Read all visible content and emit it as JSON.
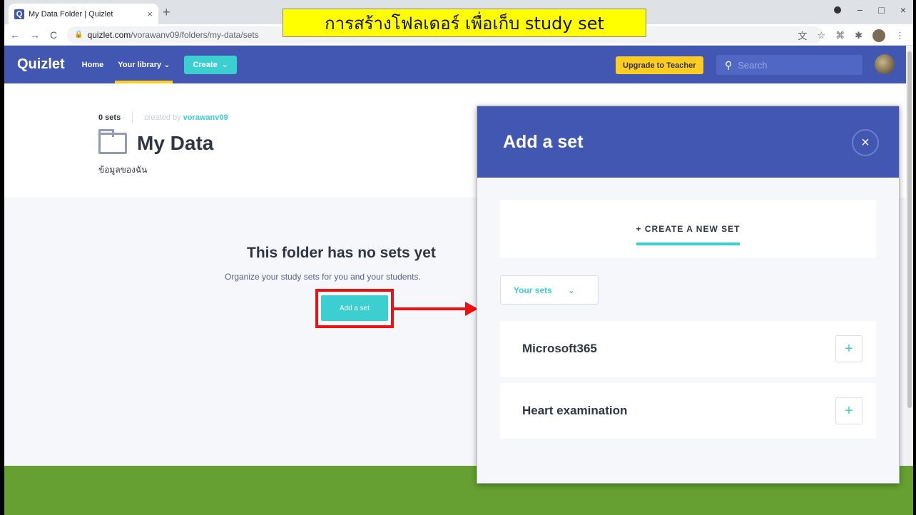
{
  "browser": {
    "tab_title": "My Data Folder | Quizlet",
    "tab_close": "×",
    "new_tab": "+",
    "url_host": "quizlet.com",
    "url_path": "/vorawanv09/folders/my-data/sets",
    "back": "←",
    "forward": "→",
    "reload": "C",
    "win_min": "−",
    "win_max": "□",
    "win_close": "×"
  },
  "banner": {
    "text": "การสร้างโฟลเดอร์ เพื่อเก็บ study set"
  },
  "nav": {
    "logo": "Quizlet",
    "home": "Home",
    "library": "Your library",
    "create": "Create",
    "upgrade": "Upgrade to Teacher",
    "search_placeholder": "Search"
  },
  "folder": {
    "set_count": "0 sets",
    "created_by": "created by",
    "username": "vorawanv09",
    "name": "My Data",
    "description": "ข้อมูลของฉัน"
  },
  "empty_state": {
    "title": "This folder has no sets yet",
    "subtitle": "Organize your study sets for you and your students.",
    "button": "Add a set"
  },
  "modal": {
    "title": "Add a set",
    "close": "×",
    "create_new": "+ CREATE A NEW SET",
    "filter": "Your sets",
    "sets": [
      {
        "name": "Microsoft365",
        "add": "+"
      },
      {
        "name": "Heart examination",
        "add": "+"
      }
    ]
  },
  "colors": {
    "primary": "#4257b2",
    "accent": "#3ccfcf",
    "upgrade": "#ffcd1f",
    "footer": "#66a032",
    "highlight": "#ee1111",
    "banner": "#ffff00"
  }
}
